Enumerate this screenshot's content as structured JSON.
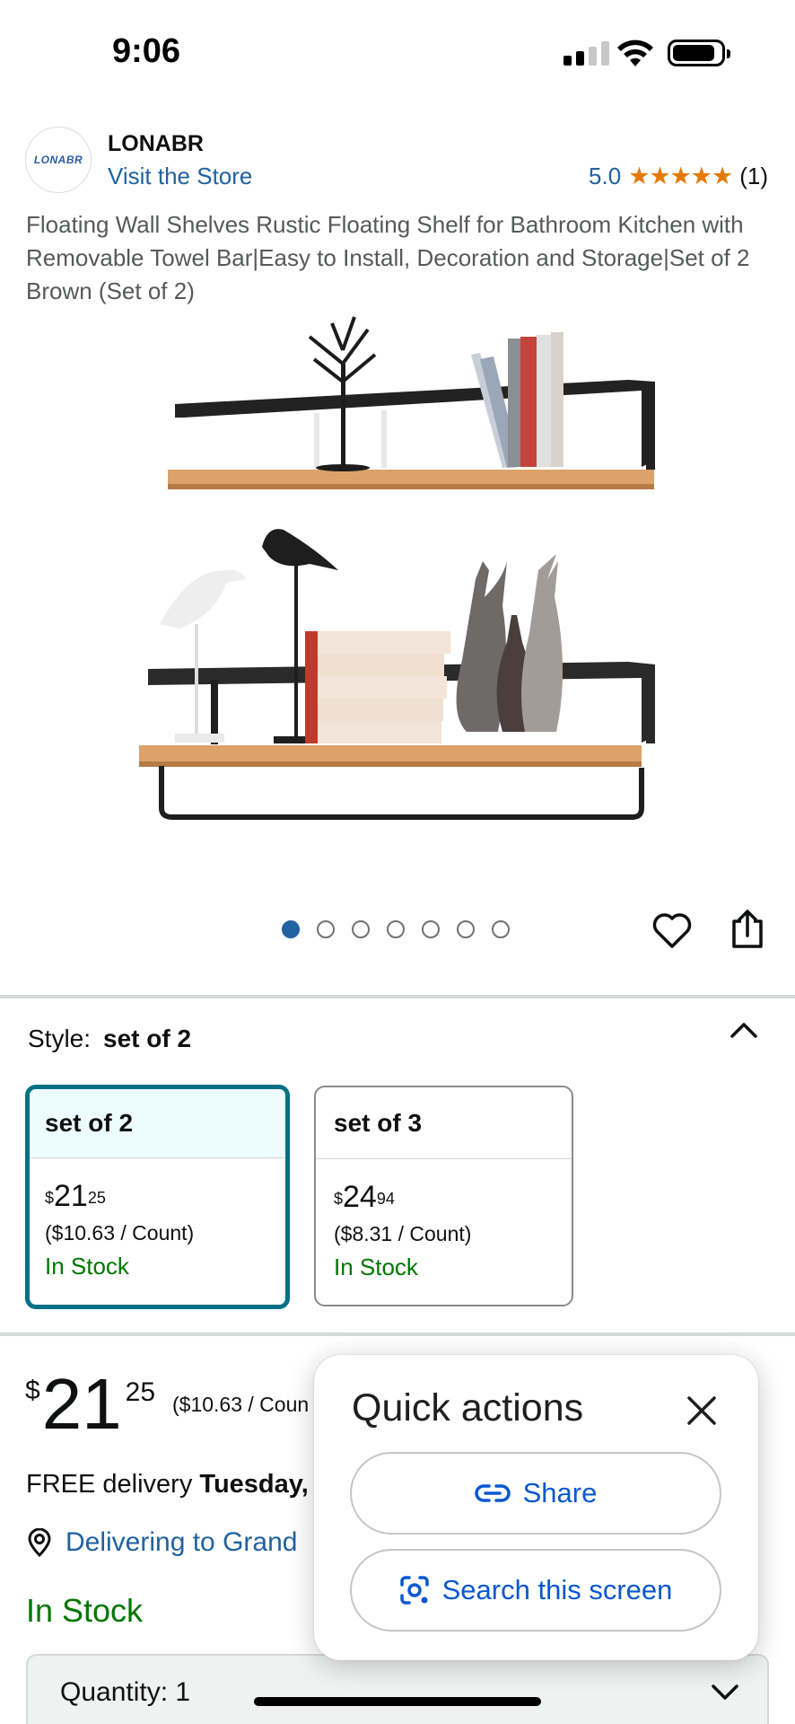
{
  "status_bar": {
    "time": "9:06"
  },
  "brand": {
    "logo_text": "LONABR",
    "name": "LONABR",
    "visit_store": "Visit the Store",
    "rating": "5.0",
    "stars": "★★★★★",
    "review_count": "(1)"
  },
  "product": {
    "title": "Floating Wall Shelves Rustic Floating Shelf for Bathroom Kitchen with Removable Towel Bar|Easy to Install, Decoration and Storage|Set of 2 Brown (Set of 2)"
  },
  "carousel": {
    "total_images": 7,
    "active_index": 0
  },
  "style": {
    "label": "Style:",
    "selected": "set of 2",
    "options": [
      {
        "name": "set of 2",
        "currency": "$",
        "whole": "21",
        "fraction": "25",
        "unit_price": "($10.63 / Count)",
        "stock": "In Stock",
        "selected": true
      },
      {
        "name": "set of 3",
        "currency": "$",
        "whole": "24",
        "fraction": "94",
        "unit_price": "($8.31 / Count)",
        "stock": "In Stock",
        "selected": false
      }
    ]
  },
  "buy_box": {
    "currency": "$",
    "price_whole": "21",
    "price_fraction": "25",
    "unit_price": "($10.63 / Coun",
    "delivery_prefix": "FREE delivery ",
    "delivery_date": "Tuesday,",
    "deliver_to": "Delivering to Grand",
    "stock": "In Stock",
    "quantity_label": "Quantity: 1"
  },
  "quick_actions": {
    "title": "Quick actions",
    "share_label": "Share",
    "search_label": "Search this screen"
  },
  "colors": {
    "link": "#2162a1",
    "star": "#e67a00",
    "in_stock": "#007600",
    "selected_border": "#007185",
    "google_blue": "#0b57d0"
  }
}
